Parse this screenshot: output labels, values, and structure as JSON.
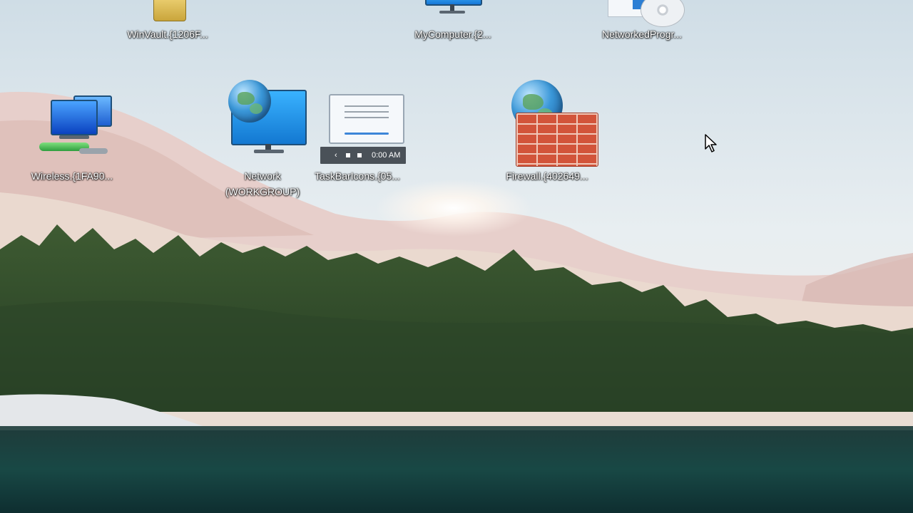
{
  "desktop": {
    "icons": [
      {
        "id": "winvault",
        "label": "WinVault.{1206F...",
        "icon": "vault-icon"
      },
      {
        "id": "mycomputer",
        "label": "MyComputer.{2...",
        "icon": "monitor-icon"
      },
      {
        "id": "networkedprograms",
        "label": "NetworkedProgr...",
        "icon": "cd-window-icon"
      },
      {
        "id": "wireless",
        "label": "Wireless.{1FA90...",
        "icon": "wireless-network-icon"
      },
      {
        "id": "network",
        "label": "Network (WORKGROUP)",
        "icon": "network-globe-monitor-icon"
      },
      {
        "id": "taskbaricons",
        "label": "TaskBarIcons.{05...",
        "icon": "taskbar-icon",
        "strip_time": "0:00 AM"
      },
      {
        "id": "firewall",
        "label": "Firewall.{402649...",
        "icon": "firewall-icon"
      }
    ]
  },
  "wallpaper": {
    "theme": "lake-forest-landscape",
    "colors": {
      "sky": "#dfe8ee",
      "hills": "#e6d0cc",
      "trees": "#2f4a2a",
      "water": "#0f3535"
    }
  },
  "cursor": {
    "icon": "arrow-cursor-icon"
  }
}
